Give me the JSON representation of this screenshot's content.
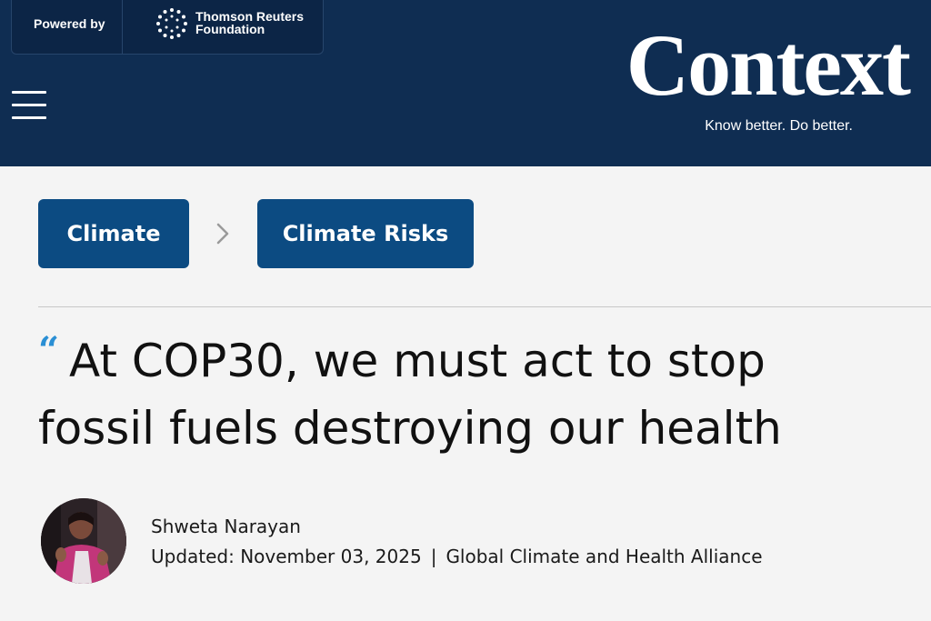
{
  "header": {
    "powered_by": "Powered by",
    "partner_line1": "Thomson Reuters",
    "partner_line2": "Foundation",
    "brand_name": "Context",
    "tagline": "Know better. Do better.",
    "menu_icon": "hamburger-menu-icon",
    "background_color": "#0f2d52"
  },
  "breadcrumb": {
    "items": [
      {
        "label": "Climate"
      },
      {
        "label": "Climate Risks"
      }
    ],
    "separator_icon": "chevron-right-icon",
    "button_color": "#0c4b82"
  },
  "article": {
    "quote_mark": "“",
    "title_line1": "At COP30, we must act to stop",
    "title_line2": "fossil fuels destroying our health",
    "author": "Shweta Narayan",
    "updated": "Updated: November 03, 2025",
    "separator": "|",
    "organization": "Global Climate and Health Alliance",
    "accent_color": "#2a8fd4"
  }
}
